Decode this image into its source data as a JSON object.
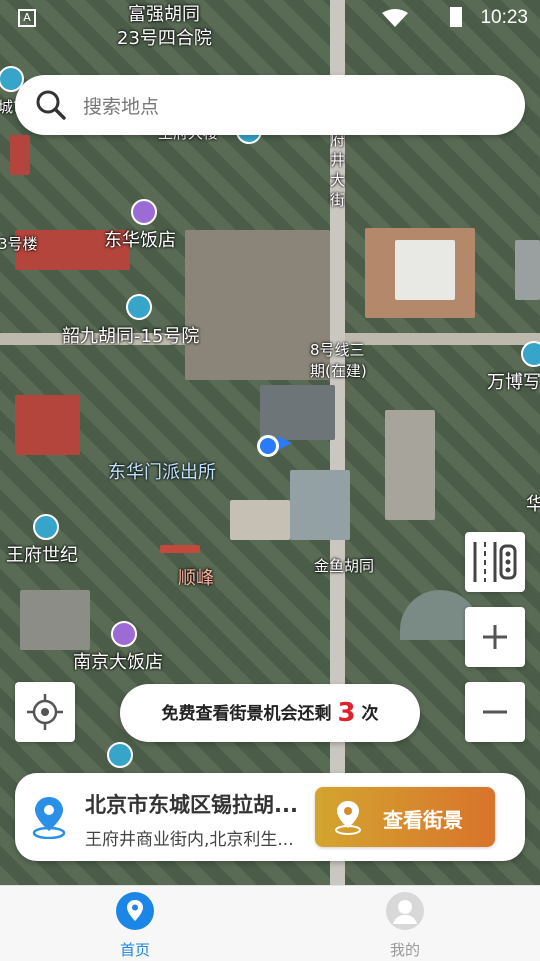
{
  "status_bar": {
    "time": "10:23"
  },
  "search": {
    "placeholder": "搜索地点"
  },
  "map_labels": {
    "fuqiang": "富强胡同",
    "siheyuan": "23号四合院",
    "dongcheng_partial": "城市",
    "street_vertical": "府井大街",
    "building_3": "3号楼",
    "donghua_hotel": "东华饭店",
    "shaojiu": "韶九胡同-15号院",
    "line8": "8号线三",
    "line8_2": "期(在建)",
    "wanbo": "万博写",
    "police": "东华门派出所",
    "wangfu_shiji": "王府世纪",
    "shunfeng": "顺峰",
    "jinyu": "金鱼胡同",
    "nanjing": "南京大饭店",
    "hua": "华",
    "top_partial": "王府大楼"
  },
  "counter": {
    "prefix": "免费查看街景机会还剩",
    "count": "3",
    "suffix": "次"
  },
  "info_card": {
    "title": "北京市东城区锡拉胡...",
    "subtitle": "王府井商业街内,北京利生...",
    "button_label": "查看街景"
  },
  "tabs": [
    {
      "label": "首页"
    },
    {
      "label": "我的"
    }
  ],
  "colors": {
    "accent": "#1c86e6",
    "button_start": "#d3a52e",
    "button_end": "#d9732c",
    "counter": "#e0202a"
  }
}
